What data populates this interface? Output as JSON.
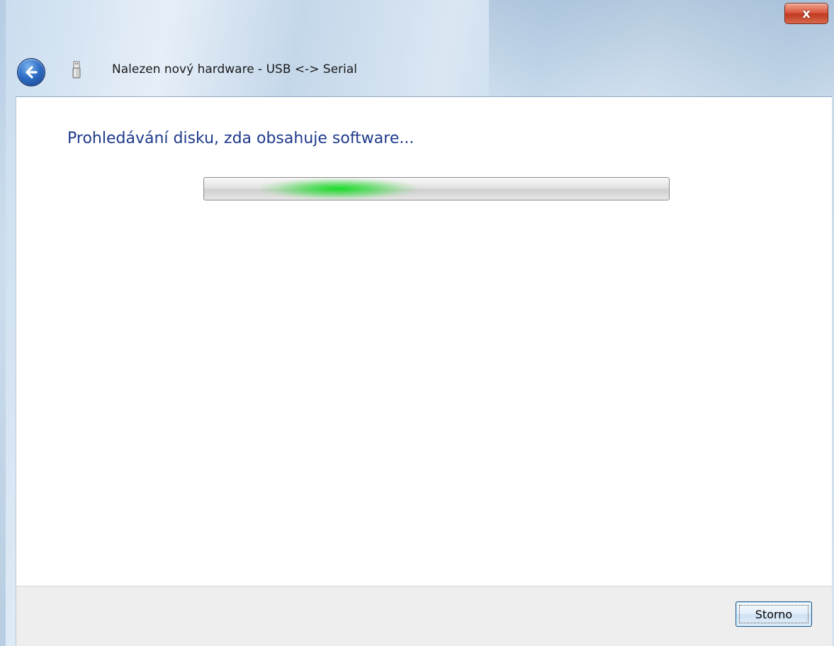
{
  "window": {
    "title": "Nalezen nový hardware - USB <-> Serial",
    "close_label": "x",
    "back_icon": "back-arrow-icon",
    "device_icon": "usb-device-icon",
    "accent_color": "#1e3a8a"
  },
  "main": {
    "heading": "Prohledávání disku, zda obsahuje software...",
    "progress": {
      "mode": "indeterminate-marquee",
      "fill_color": "#19dc28"
    }
  },
  "footer": {
    "cancel_label": "Storno"
  }
}
